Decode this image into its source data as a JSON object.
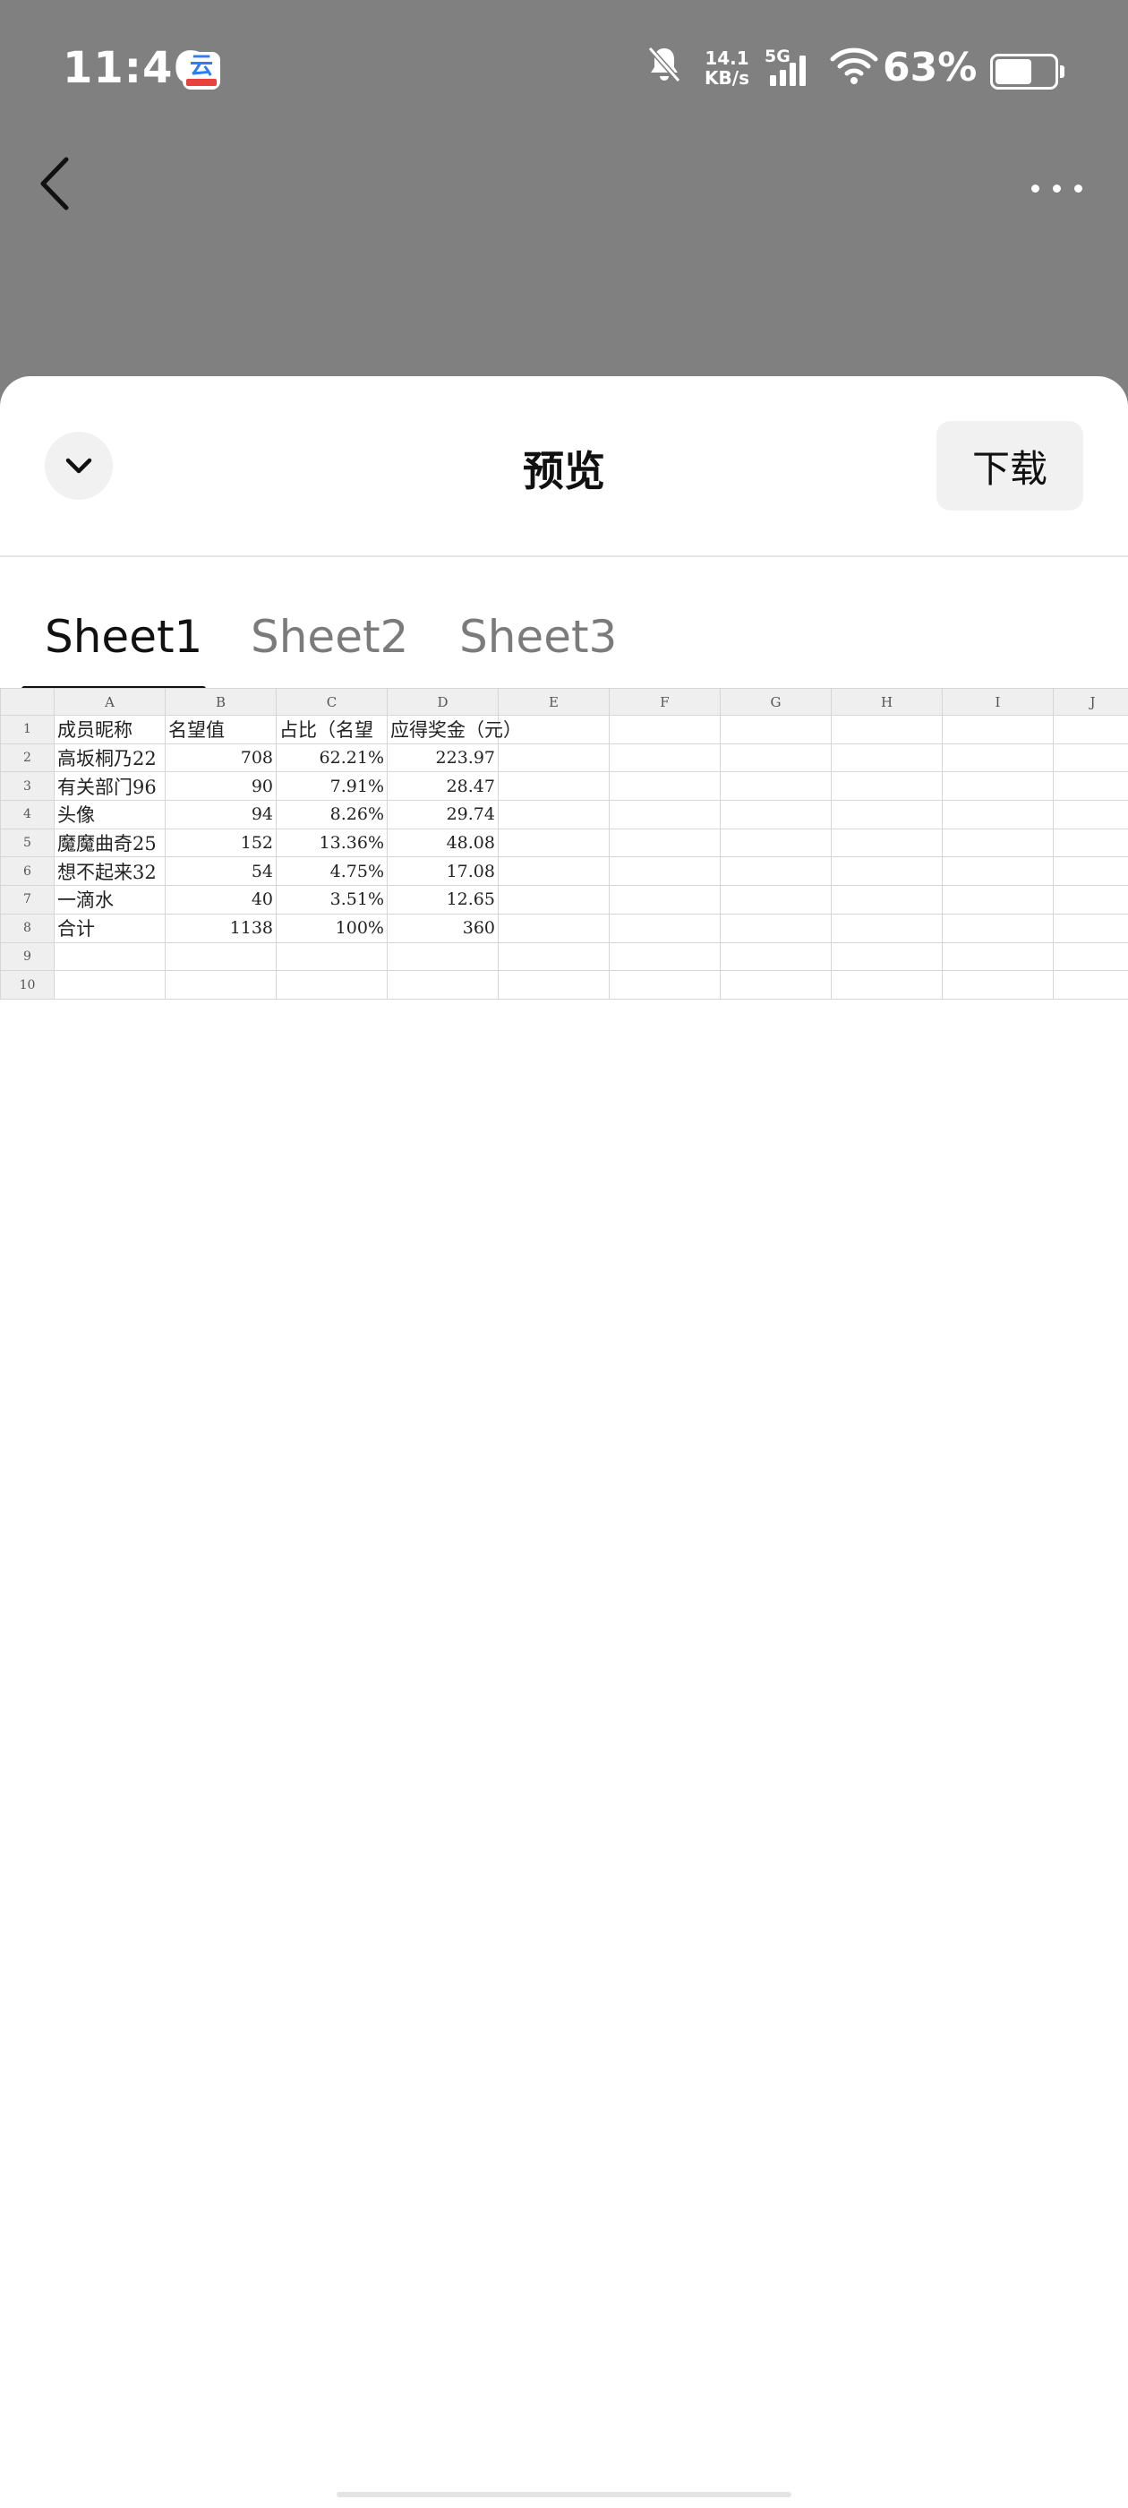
{
  "status_bar": {
    "time": "11:46",
    "net_speed_value": "14.1",
    "net_speed_unit": "KB/s",
    "signal_label": "5G",
    "battery_percent": "63%",
    "battery_level": 0.63,
    "app_badge_glyph": "云"
  },
  "nav": {
    "back_icon": "chevron-left-icon",
    "more_icon": "more-dots-icon"
  },
  "sheet": {
    "title": "预览",
    "download_label": "下载",
    "collapse_icon": "chevron-down-icon",
    "tabs": [
      {
        "label": "Sheet1",
        "active": true
      },
      {
        "label": "Sheet2",
        "active": false
      },
      {
        "label": "Sheet3",
        "active": false
      }
    ]
  },
  "spreadsheet": {
    "column_headers": [
      "A",
      "B",
      "C",
      "D",
      "E",
      "F",
      "G",
      "H",
      "I",
      "J"
    ],
    "row_numbers": [
      "1",
      "2",
      "3",
      "4",
      "5",
      "6",
      "7",
      "8",
      "9",
      "10"
    ],
    "rows": [
      [
        "成员昵称",
        "名望值",
        "占比（名望",
        "应得奖金（元）"
      ],
      [
        "高坂桐乃22",
        "708",
        "62.21%",
        "223.97"
      ],
      [
        "有关部门96",
        "90",
        "7.91%",
        "28.47"
      ],
      [
        "头像",
        "94",
        "8.26%",
        "29.74"
      ],
      [
        "魔魔曲奇25",
        "152",
        "13.36%",
        "48.08"
      ],
      [
        "想不起来32",
        "54",
        "4.75%",
        "17.08"
      ],
      [
        "一滴水",
        "40",
        "3.51%",
        "12.65"
      ],
      [
        "合计",
        "1138",
        "100%",
        "360"
      ],
      [
        "",
        "",
        "",
        ""
      ],
      [
        "",
        "",
        "",
        ""
      ]
    ]
  }
}
